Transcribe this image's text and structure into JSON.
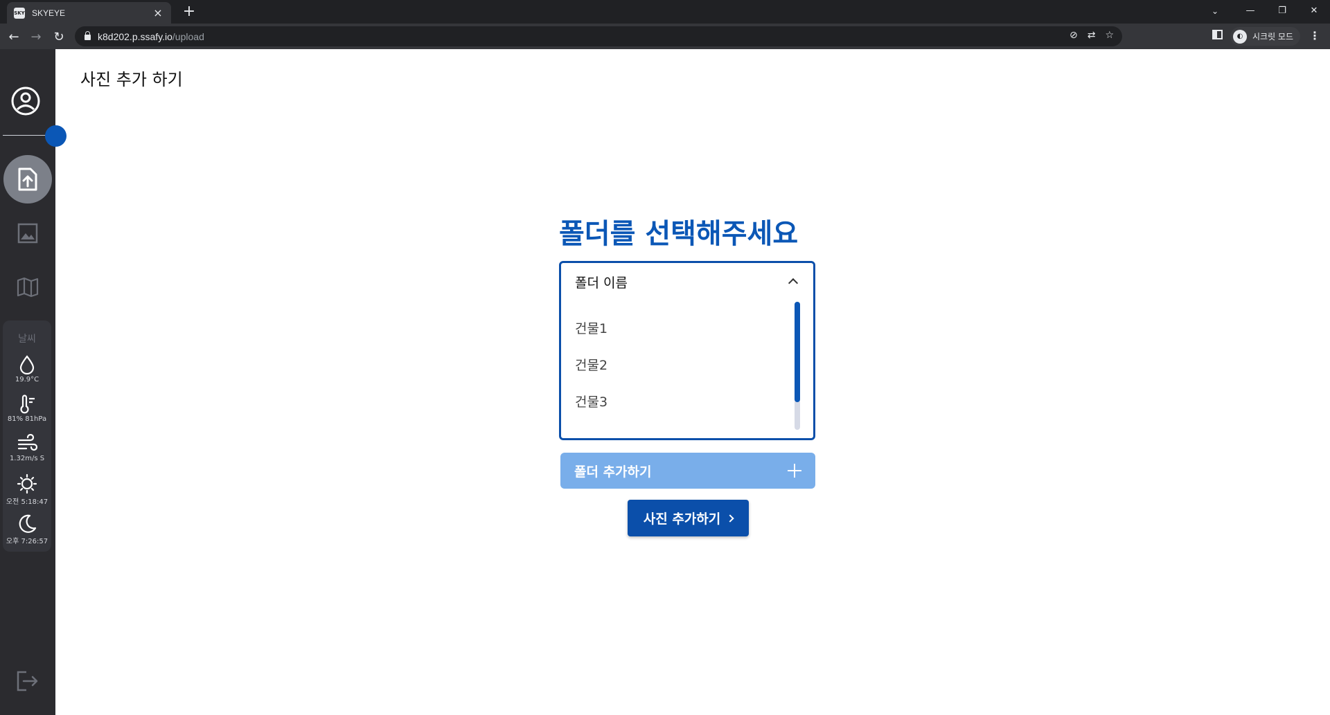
{
  "browser": {
    "tab_title": "SKYEYE",
    "favicon_text": "SKY",
    "url_host": "k8d202.p.ssafy.io",
    "url_path": "/upload",
    "incognito_label": "시크릿 모드"
  },
  "sidebar": {
    "weather_title": "날씨",
    "weather": [
      {
        "icon": "water-drop-icon",
        "value": "19.9°C"
      },
      {
        "icon": "thermometer-icon",
        "value": "81% 81hPa"
      },
      {
        "icon": "wind-icon",
        "value": "1.32m/s S"
      },
      {
        "icon": "sunrise-icon",
        "value": "오전 5:18:47"
      },
      {
        "icon": "moon-icon",
        "value": "오후 7:26:57"
      }
    ]
  },
  "main": {
    "page_title": "사진 추가 하기",
    "heading": "폴더를 선택해주세요",
    "select": {
      "header": "폴더 이름",
      "options": [
        "건물1",
        "건물2",
        "건물3"
      ],
      "scroll_position": 0.78
    },
    "add_folder_label": "폴더 추가하기",
    "add_photo_label": "사진 추가하기"
  },
  "colors": {
    "accent": "#0b57b6",
    "accent_light": "#79aeea",
    "sidebar_bg": "#2b2b2f"
  }
}
